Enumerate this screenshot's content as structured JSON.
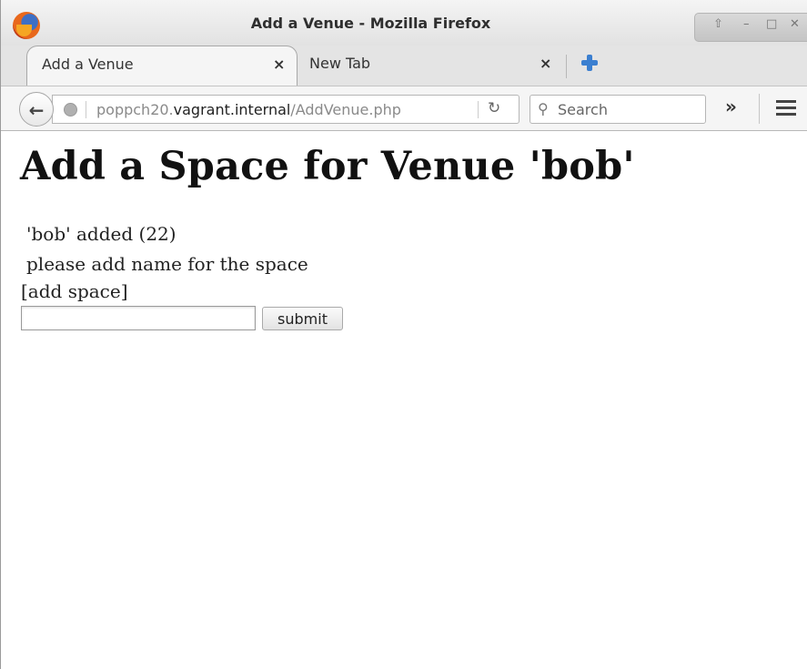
{
  "window": {
    "title": "Add a Venue - Mozilla Firefox",
    "controls": {
      "up": "⇧",
      "minimize": "–",
      "maximize": "□",
      "close": "✕"
    }
  },
  "tabs": [
    {
      "label": "Add a Venue",
      "close": "×",
      "active": true
    },
    {
      "label": "New Tab",
      "close": "×",
      "active": false
    }
  ],
  "navbar": {
    "back_glyph": "←",
    "url": {
      "host_prefix": "poppch20.",
      "domain": "vagrant.internal",
      "path": "/AddVenue.php"
    },
    "reload_glyph": "↻",
    "search_placeholder": "Search",
    "overflow_glyph": "»"
  },
  "page": {
    "heading": "Add a Space for Venue 'bob'",
    "added_message": "'bob' added (22)",
    "prompt_message": "please add name for the space",
    "section_label": "[add space]",
    "space_name_value": "",
    "submit_label": "submit"
  },
  "colors": {
    "link_accent": "#3b7fd0",
    "titlebar": "#e8e8e8",
    "page_background": "#ffffff"
  }
}
